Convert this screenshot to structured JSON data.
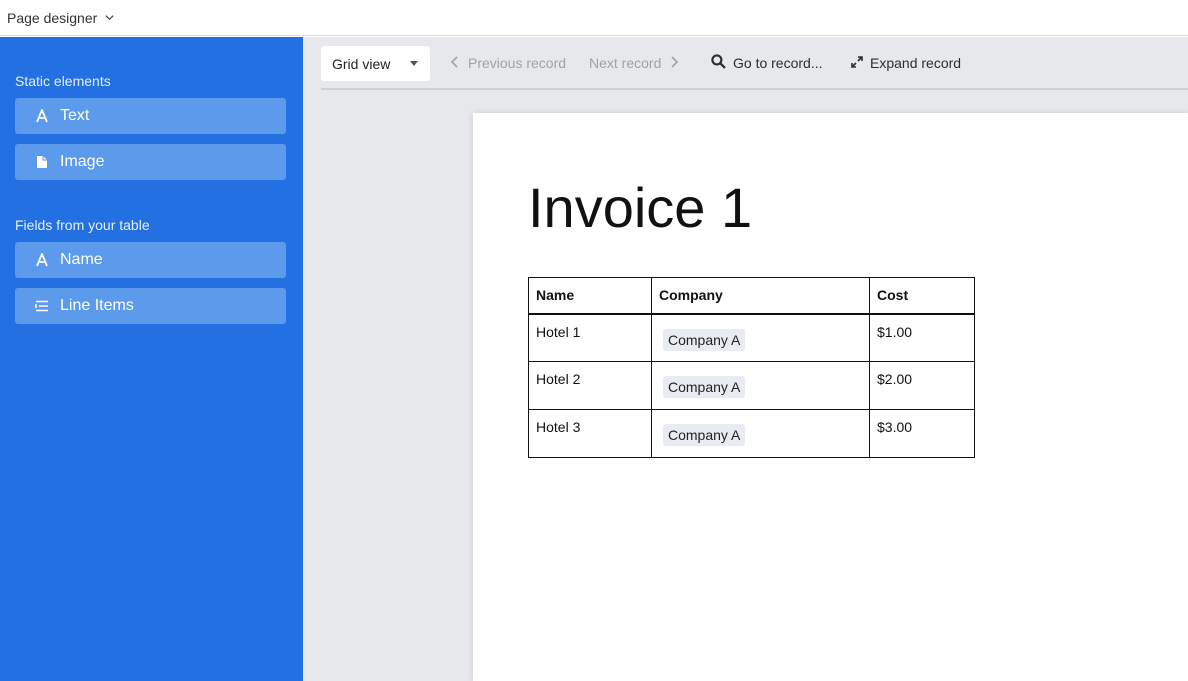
{
  "header": {
    "title": "Page designer"
  },
  "sidebar": {
    "static_label": "Static elements",
    "static_items": [
      {
        "label": "Text",
        "icon": "text-icon"
      },
      {
        "label": "Image",
        "icon": "file-icon"
      }
    ],
    "fields_label": "Fields from your table",
    "field_items": [
      {
        "label": "Name",
        "icon": "text-icon"
      },
      {
        "label": "Line Items",
        "icon": "list-icon"
      }
    ]
  },
  "toolbar": {
    "view": "Grid view",
    "prev": "Previous record",
    "next": "Next record",
    "goto": "Go to record...",
    "expand": "Expand record"
  },
  "page": {
    "title": "Invoice 1",
    "columns": [
      "Name",
      "Company",
      "Cost"
    ],
    "rows": [
      {
        "name": "Hotel 1",
        "company": "Company A",
        "cost": "$1.00"
      },
      {
        "name": "Hotel 2",
        "company": "Company A",
        "cost": "$2.00"
      },
      {
        "name": "Hotel 3",
        "company": "Company A",
        "cost": "$3.00"
      }
    ]
  },
  "colors": {
    "sidebar": "#2370e3",
    "sidebar_button": "#5c9aec",
    "main_bg": "#e6e8eb",
    "chip_bg": "#e9ebf3"
  }
}
